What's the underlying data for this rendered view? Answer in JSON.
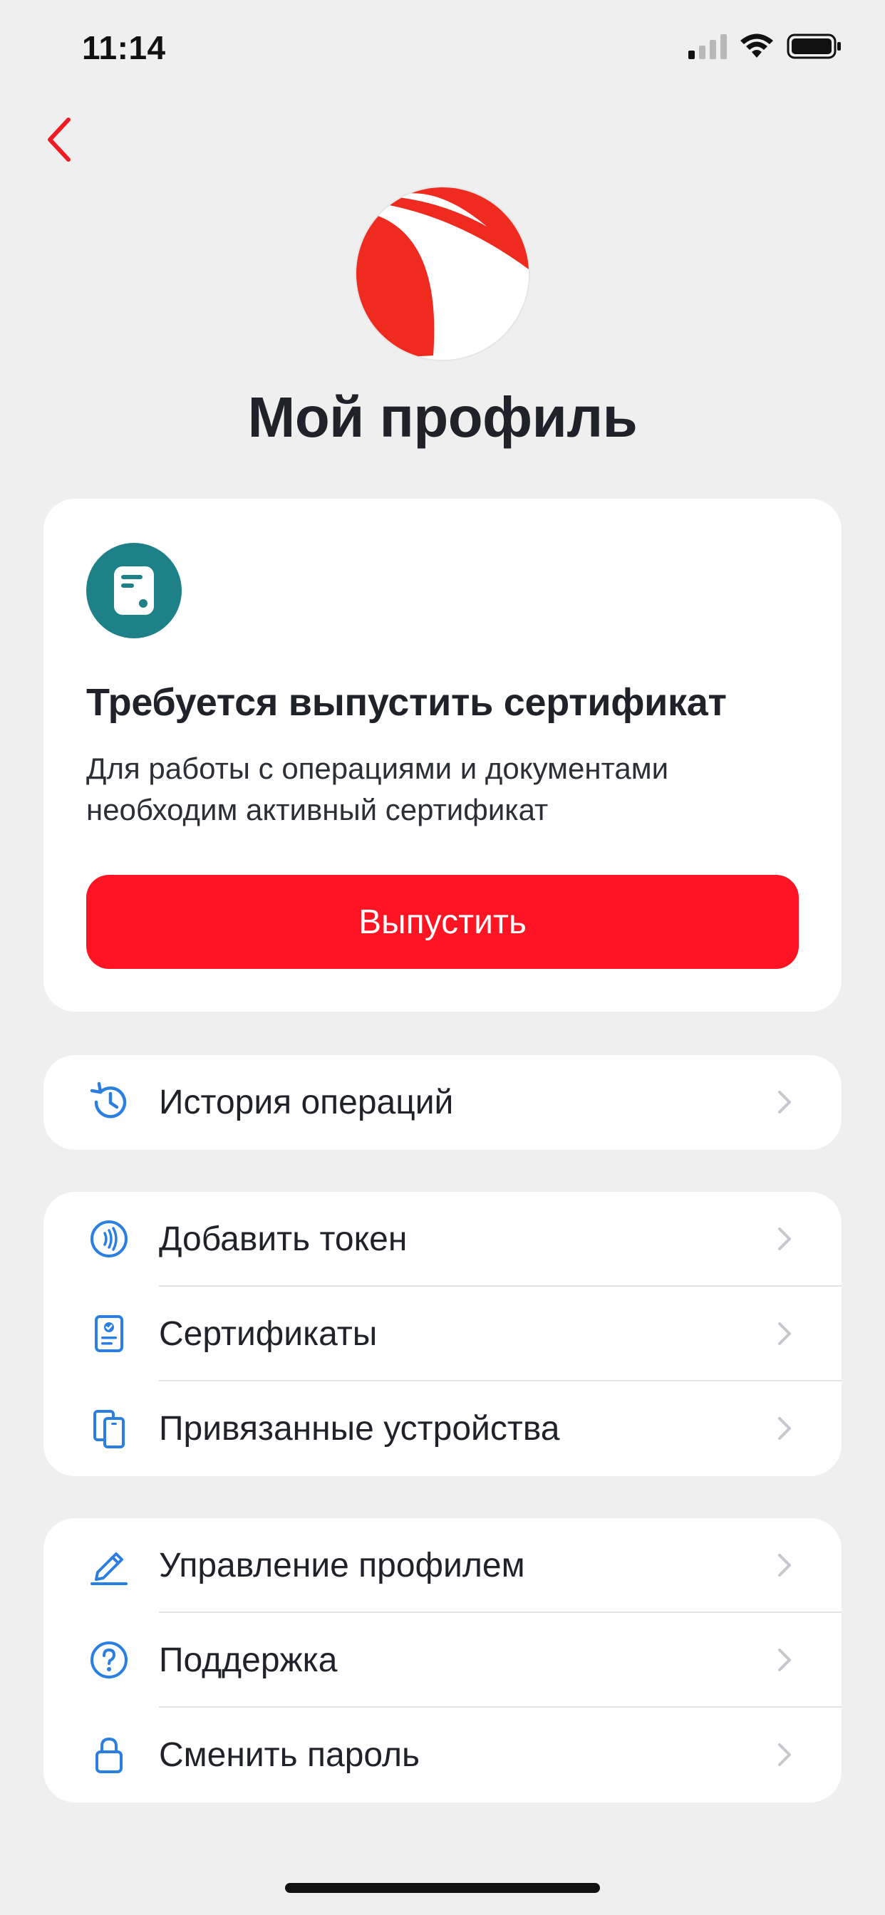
{
  "status_bar": {
    "time": "11:14"
  },
  "header": {
    "title": "Мой профиль"
  },
  "certificate_card": {
    "title": "Требуется выпустить сертификат",
    "description": "Для работы с операциями и документами необходим активный сертификат",
    "button_label": "Выпустить"
  },
  "history": {
    "label": "История операций",
    "icon": "history-icon"
  },
  "group1": {
    "items": [
      {
        "label": "Добавить токен",
        "icon": "nfc-token-icon"
      },
      {
        "label": "Сертификаты",
        "icon": "certificate-icon"
      },
      {
        "label": "Привязанные устройства",
        "icon": "devices-icon"
      }
    ]
  },
  "group2": {
    "items": [
      {
        "label": "Управление профилем",
        "icon": "pencil-icon"
      },
      {
        "label": "Поддержка",
        "icon": "help-icon"
      },
      {
        "label": "Сменить пароль",
        "icon": "lock-icon"
      }
    ]
  },
  "colors": {
    "accent_red": "#ff1424",
    "icon_blue": "#2a7fe0",
    "teal": "#1f8188",
    "background": "#efefef"
  }
}
